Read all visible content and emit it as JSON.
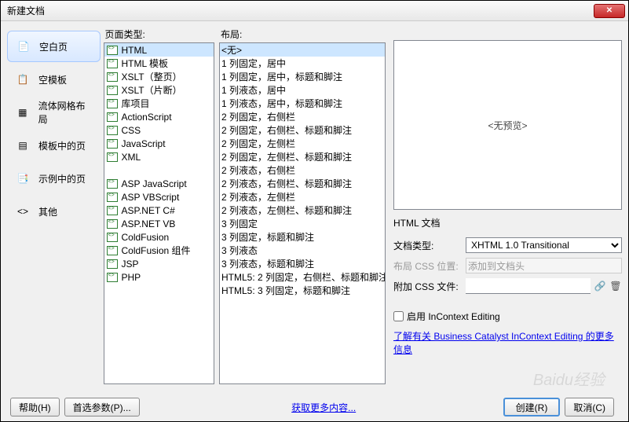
{
  "titlebar": {
    "title": "新建文档"
  },
  "nav": {
    "items": [
      {
        "label": "空白页"
      },
      {
        "label": "空模板"
      },
      {
        "label": "流体网格布局"
      },
      {
        "label": "模板中的页"
      },
      {
        "label": "示例中的页"
      },
      {
        "label": "其他"
      }
    ]
  },
  "columns": {
    "page_type_label": "页面类型:",
    "layout_label": "布局:"
  },
  "page_types": [
    "HTML",
    "HTML 模板",
    "XSLT（整页）",
    "XSLT（片断）",
    "库项目",
    "ActionScript",
    "CSS",
    "JavaScript",
    "XML",
    "",
    "ASP JavaScript",
    "ASP VBScript",
    "ASP.NET C#",
    "ASP.NET VB",
    "ColdFusion",
    "ColdFusion 组件",
    "JSP",
    "PHP"
  ],
  "layouts": [
    "<无>",
    "1 列固定，居中",
    "1 列固定，居中，标题和脚注",
    "1 列液态，居中",
    "1 列液态，居中，标题和脚注",
    "2 列固定，右侧栏",
    "2 列固定，右侧栏、标题和脚注",
    "2 列固定，左侧栏",
    "2 列固定，左侧栏、标题和脚注",
    "2 列液态，右侧栏",
    "2 列液态，右侧栏、标题和脚注",
    "2 列液态，左侧栏",
    "2 列液态，左侧栏、标题和脚注",
    "3 列固定",
    "3 列固定，标题和脚注",
    "3 列液态",
    "3 列液态，标题和脚注",
    "HTML5: 2 列固定，右侧栏、标题和脚注",
    "HTML5: 3 列固定，标题和脚注"
  ],
  "preview": {
    "no_preview": "<无预览>",
    "desc": "HTML 文档"
  },
  "form": {
    "doctype_label": "文档类型:",
    "doctype_value": "XHTML 1.0 Transitional",
    "layout_css_label": "布局 CSS 位置:",
    "layout_css_value": "添加到文档头",
    "attach_css_label": "附加 CSS 文件:",
    "attach_css_value": "",
    "enable_incontext": "启用 InContext Editing",
    "link_text": "了解有关 Business Catalyst InContext Editing 的更多信息"
  },
  "footer": {
    "help": "帮助(H)",
    "prefs": "首选参数(P)...",
    "more": "获取更多内容...",
    "create": "创建(R)",
    "cancel": "取消(C)"
  }
}
